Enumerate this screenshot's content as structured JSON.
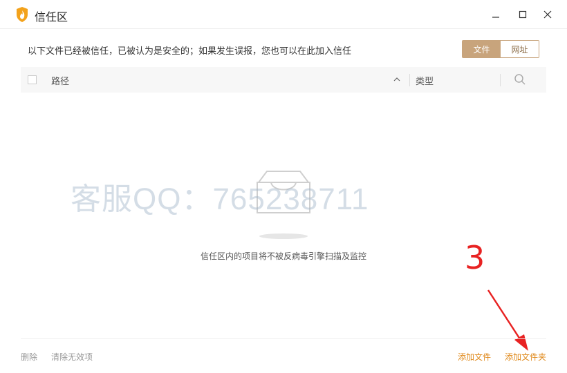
{
  "window": {
    "title": "信任区",
    "logo_icon": "shield-flame-icon",
    "controls": {
      "minimize_icon": "minimize-icon",
      "maximize_icon": "maximize-icon",
      "close_icon": "close-icon"
    }
  },
  "header": {
    "info_text": "以下文件已经被信任，已被认为是安全的；如果发生误报，您也可以在此加入信任",
    "tabs": [
      {
        "label": "文件",
        "active": true
      },
      {
        "label": "网址",
        "active": false
      }
    ]
  },
  "table": {
    "columns": {
      "path": "路径",
      "type": "类型"
    },
    "sort_icon": "chevron-up-icon",
    "search_icon": "search-icon",
    "rows": []
  },
  "empty_state": {
    "icon": "empty-box-icon",
    "text": "信任区内的项目将不被反病毒引擎扫描及监控"
  },
  "overlay": {
    "watermark": "客服QQ：765238711",
    "annotation_number": "3"
  },
  "footer": {
    "delete": "删除",
    "clear_invalid": "清除无效项",
    "add_file": "添加文件",
    "add_folder": "添加文件夹"
  },
  "colors": {
    "accent_gold": "#c8a47c",
    "link_orange": "#e08a1c",
    "annotation_red": "#e82222"
  }
}
